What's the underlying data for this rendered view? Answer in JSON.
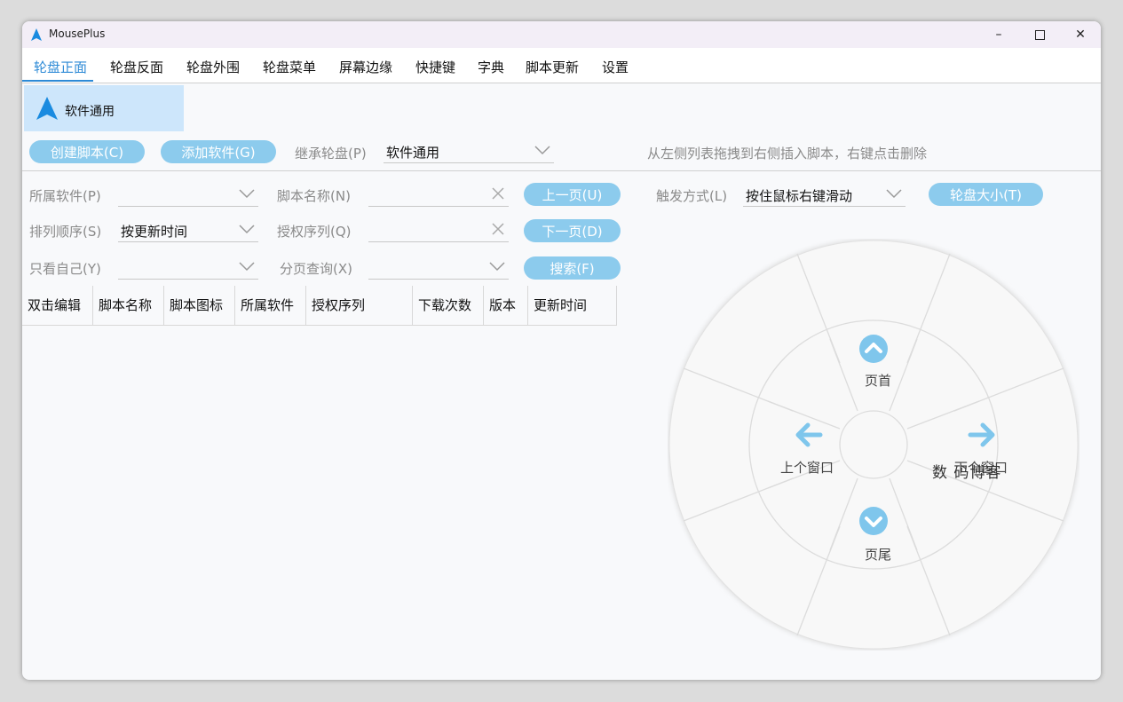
{
  "window": {
    "title": "MousePlus",
    "controls": {
      "minimize": "–",
      "maximize": "☐",
      "close": "✕"
    }
  },
  "menu": {
    "items": [
      "轮盘正面",
      "轮盘反面",
      "轮盘外围",
      "轮盘菜单",
      "屏幕边缘",
      "快捷键",
      "字典",
      "脚本更新",
      "设置"
    ],
    "active_index": 0
  },
  "software_tile": {
    "label": "软件通用"
  },
  "toolbar": {
    "create_script": "创建脚本(C)",
    "add_software": "添加软件(G)",
    "inherit_label": "继承轮盘(P)",
    "inherit_value": "软件通用",
    "hint": "从左侧列表拖拽到右侧插入脚本，右键点击删除"
  },
  "filters": {
    "software_label": "所属软件(P)",
    "software_value": "",
    "script_name_label": "脚本名称(N)",
    "script_name_value": "",
    "prev_page": "上一页(U)",
    "trigger_label": "触发方式(L)",
    "trigger_value": "按住鼠标右键滑动",
    "wheel_size": "轮盘大小(T)",
    "sort_label": "排列顺序(S)",
    "sort_value": "按更新时间",
    "license_label": "授权序列(Q)",
    "license_value": "",
    "next_page": "下一页(D)",
    "mine_label": "只看自己(Y)",
    "mine_value": "",
    "page_query_label": "分页查询(X)",
    "page_query_value": "",
    "search": "搜索(F)"
  },
  "table": {
    "columns": [
      "双击编辑",
      "脚本名称",
      "脚本图标",
      "所属软件",
      "授权序列",
      "下载次数",
      "版本",
      "更新时间"
    ],
    "rows": []
  },
  "wheel": {
    "top": {
      "label": "页首",
      "icon": "chevron-up-circle"
    },
    "left": {
      "label": "上个窗口",
      "icon": "arrow-left"
    },
    "right": {
      "label": "下个窗口",
      "icon": "arrow-right"
    },
    "right_overlay": "数  码博客",
    "bottom": {
      "label": "页尾",
      "icon": "chevron-down-circle"
    }
  },
  "colors": {
    "accent": "#2d8ad6",
    "pill": "#8ccbed",
    "icon": "#7fc6ec",
    "tile": "#cde6fb"
  }
}
